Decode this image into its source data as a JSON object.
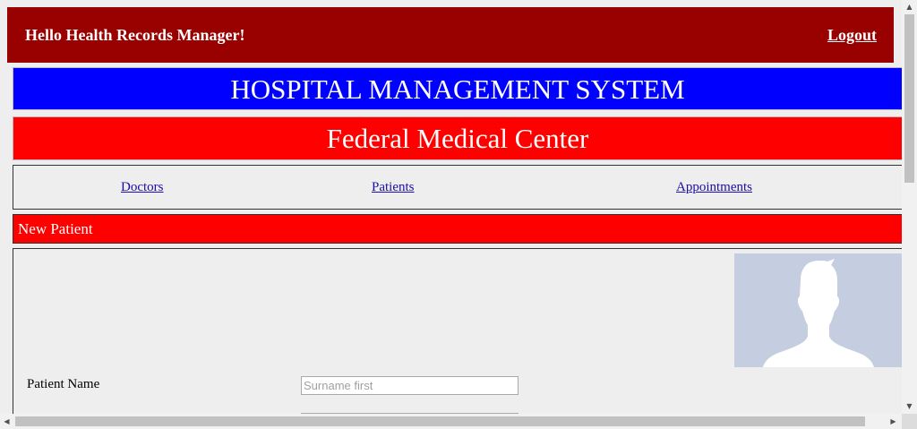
{
  "topbar": {
    "greeting": "Hello Health Records Manager!",
    "logout_label": "Logout"
  },
  "banners": {
    "system_title": "HOSPITAL MANAGEMENT SYSTEM",
    "hospital_name": "Federal Medical Center"
  },
  "nav": {
    "items": [
      {
        "label": "Doctors"
      },
      {
        "label": "Patients"
      },
      {
        "label": "Appointments"
      }
    ]
  },
  "section": {
    "title": "New Patient"
  },
  "form": {
    "fields": [
      {
        "label": "Patient Name",
        "placeholder": "Surname first",
        "value": ""
      },
      {
        "label": "",
        "placeholder": "",
        "value": ""
      }
    ]
  },
  "colors": {
    "topbar_bg": "#990000",
    "system_banner_bg": "#0000ff",
    "hospital_banner_bg": "#ff0000",
    "section_header_bg": "#ff0000",
    "page_bg": "#eeeeee",
    "photo_placeholder_bg": "#c5cee0"
  },
  "icons": {
    "photo": "default-avatar-silhouette",
    "scroll_up": "arrow-up-icon",
    "scroll_down": "arrow-down-icon",
    "scroll_left": "arrow-left-icon",
    "scroll_right": "arrow-right-icon"
  }
}
